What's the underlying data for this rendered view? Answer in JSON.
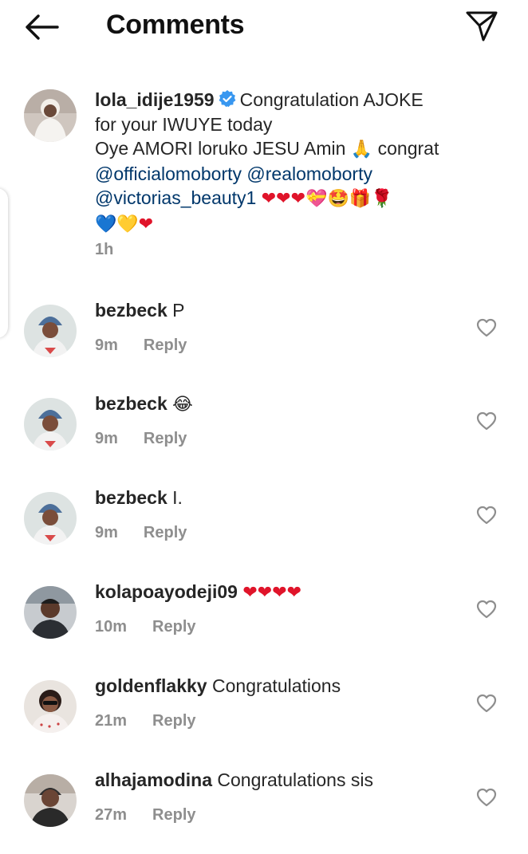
{
  "header": {
    "title": "Comments",
    "back_icon": "arrow-left-icon",
    "share_icon": "paper-plane-icon"
  },
  "caption": {
    "username": "lola_idije1959",
    "text_line1": "Congratulation AJOKE",
    "text_line2": "for your IWUYE today",
    "text_line3a": "Oye AMORI loruko JESU Amin",
    "text_line3b": "congrat",
    "mention1": "@officialomoborty",
    "mention2": "@realomoborty",
    "mention3": "@victorias_beauty1",
    "emoji_pray": "🙏",
    "emoji_line4": "💝🤩🎁🌹",
    "emoji_line5": "💙💛",
    "time": "1h"
  },
  "comments": [
    {
      "username": "bezbeck",
      "text": "P",
      "time": "9m",
      "reply": "Reply"
    },
    {
      "username": "bezbeck",
      "text": "😂",
      "time": "9m",
      "reply": "Reply"
    },
    {
      "username": "bezbeck",
      "text": "I.",
      "time": "9m",
      "reply": "Reply"
    },
    {
      "username": "kolapoayodeji09",
      "text": "",
      "time": "10m",
      "reply": "Reply"
    },
    {
      "username": "goldenflakky",
      "text": "Congratulations",
      "time": "21m",
      "reply": "Reply"
    },
    {
      "username": "alhajamodina",
      "text": "Congratulations sis",
      "time": "27m",
      "reply": "Reply"
    }
  ],
  "colors": {
    "text": "#262626",
    "secondary": "#8e8e8e",
    "mention": "#00376b",
    "verified": "#3897f0",
    "heart": "#e0142a"
  }
}
